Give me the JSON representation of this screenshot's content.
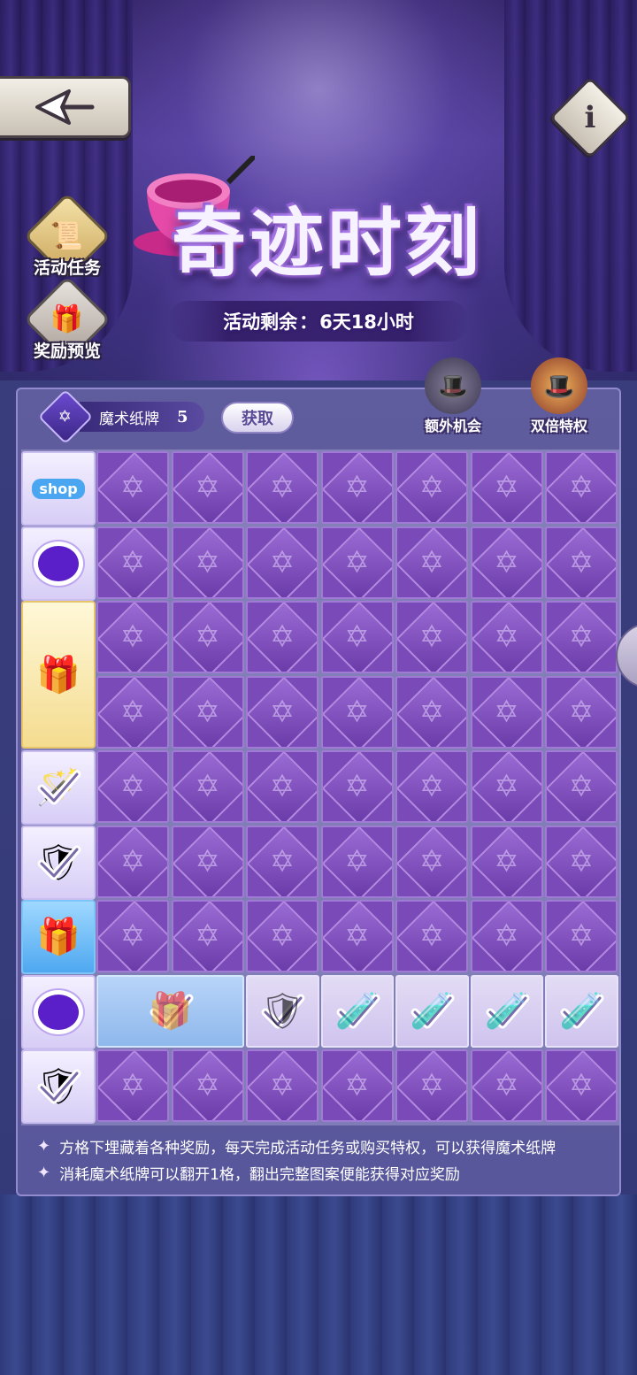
{
  "header": {
    "title": "奇迹时刻",
    "countdown_label": "活动剩余",
    "countdown_value": "6天18小时"
  },
  "side_menu": [
    {
      "label": "活动任务",
      "icon": "scroll-icon"
    },
    {
      "label": "奖励预览",
      "icon": "gift-icon"
    }
  ],
  "cards": {
    "label": "魔术纸牌",
    "count": "5",
    "obtain_button": "获取"
  },
  "privileges": [
    {
      "label": "额外机会",
      "icon": "bunny-hat-icon"
    },
    {
      "label": "双倍特权",
      "icon": "bunny-hat-gold-icon"
    }
  ],
  "grid": {
    "rows": 9,
    "cols": 7,
    "row_rewards": [
      {
        "icon": "shop-badge-icon",
        "label": "shop"
      },
      {
        "icon": "purple-crystal-icon"
      },
      {
        "icon": "gift-box-icon"
      },
      {
        "icon": "gift-box-icon"
      },
      {
        "icon": "wand-collected-icon",
        "collected": true
      },
      {
        "icon": "shield-collected-icon",
        "collected": true
      },
      {
        "icon": "blue-gift-icon"
      },
      {
        "icon": "purple-crystal-icon"
      },
      {
        "icon": "shield-collected-icon",
        "collected": true
      }
    ],
    "open_row_index": 7,
    "open_row_cells": [
      {
        "icon": "blue-gift-icon",
        "collected": true,
        "span": 2
      },
      {
        "icon": "shield-icon",
        "collected": true
      },
      {
        "icon": "potion-icon",
        "collected": true
      },
      {
        "icon": "potion-icon",
        "collected": true
      },
      {
        "icon": "potion-icon",
        "collected": true
      },
      {
        "icon": "potion-icon",
        "collected": true
      }
    ]
  },
  "notes": [
    "方格下埋藏着各种奖励，每天完成活动任务或购买特权，可以获得魔术纸牌",
    "消耗魔术纸牌可以翻开1格，翻出完整图案便能获得对应奖励"
  ],
  "colors": {
    "cell_closed": "#7a4ab8",
    "cell_open": "#e3dcf4",
    "panel": "#736eaf",
    "accent": "#5a1fc8"
  }
}
